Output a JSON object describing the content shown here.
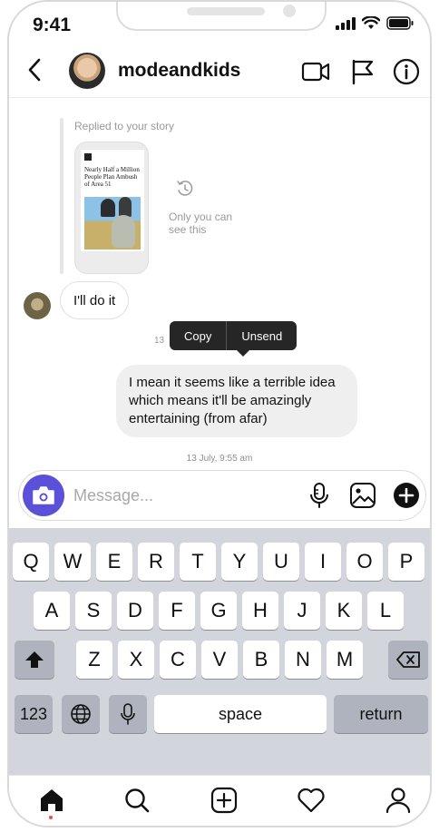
{
  "status_bar": {
    "time": "9:41"
  },
  "header": {
    "username": "modeandkids"
  },
  "story_reply": {
    "label": "Replied to your story",
    "article_headline": "Nearly Half a Million People Plan Ambush of Area 51",
    "only_you_text": "Only you can see this"
  },
  "messages": [
    {
      "from": "them",
      "text": "I'll do it"
    },
    {
      "from": "me",
      "text": "I mean it seems like a terrible idea which means it'll be amazingly entertaining (from afar)"
    }
  ],
  "context_menu": {
    "copy_label": "Copy",
    "unsend_label": "Unsend",
    "partial_timestamp": "13"
  },
  "sent_timestamp": "13 July, 9:55 am",
  "composer": {
    "placeholder": "Message..."
  },
  "keyboard": {
    "row1": [
      "Q",
      "W",
      "E",
      "R",
      "T",
      "Y",
      "U",
      "I",
      "O",
      "P"
    ],
    "row2": [
      "A",
      "S",
      "D",
      "F",
      "G",
      "H",
      "J",
      "K",
      "L"
    ],
    "row3": [
      "Z",
      "X",
      "C",
      "V",
      "B",
      "N",
      "M"
    ],
    "numbers_label": "123",
    "space_label": "space",
    "return_label": "return"
  },
  "colors": {
    "accent": "#5b51d8",
    "keyboard_bg": "#d2d5db",
    "menu_bg": "#262626",
    "notification_dot": "#ed4956"
  },
  "icons": {
    "header": [
      "back-icon",
      "video-call-icon",
      "flag-icon",
      "info-icon"
    ],
    "composer": [
      "camera-icon",
      "microphone-icon",
      "gallery-icon",
      "plus-icon"
    ],
    "tabbar": [
      "home-icon",
      "search-icon",
      "new-post-icon",
      "activity-heart-icon",
      "profile-icon"
    ]
  }
}
